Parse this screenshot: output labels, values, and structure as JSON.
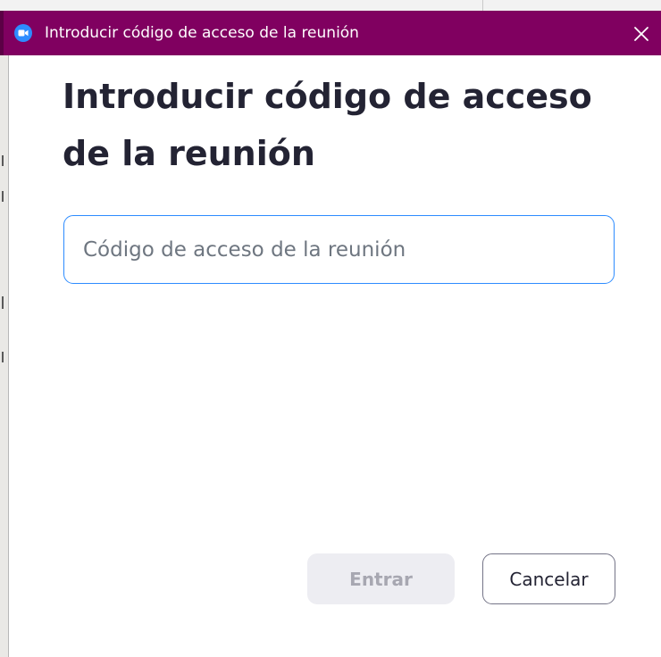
{
  "window": {
    "title": "Introducir código de acceso de la reunión",
    "app_icon": "zoom-camera-icon",
    "close_icon": "close-icon",
    "titlebar_color": "#800060"
  },
  "dialog": {
    "heading": "Introducir código de acceso de la reunión",
    "input": {
      "placeholder": "Código de acceso de la reunión",
      "value": ""
    },
    "buttons": {
      "enter_label": "Entrar",
      "enter_enabled": false,
      "cancel_label": "Cancelar"
    }
  },
  "colors": {
    "accent": "#2d8cff",
    "text": "#232333",
    "disabled_button_bg": "#ededf2",
    "disabled_button_text": "#a7a7b1"
  }
}
